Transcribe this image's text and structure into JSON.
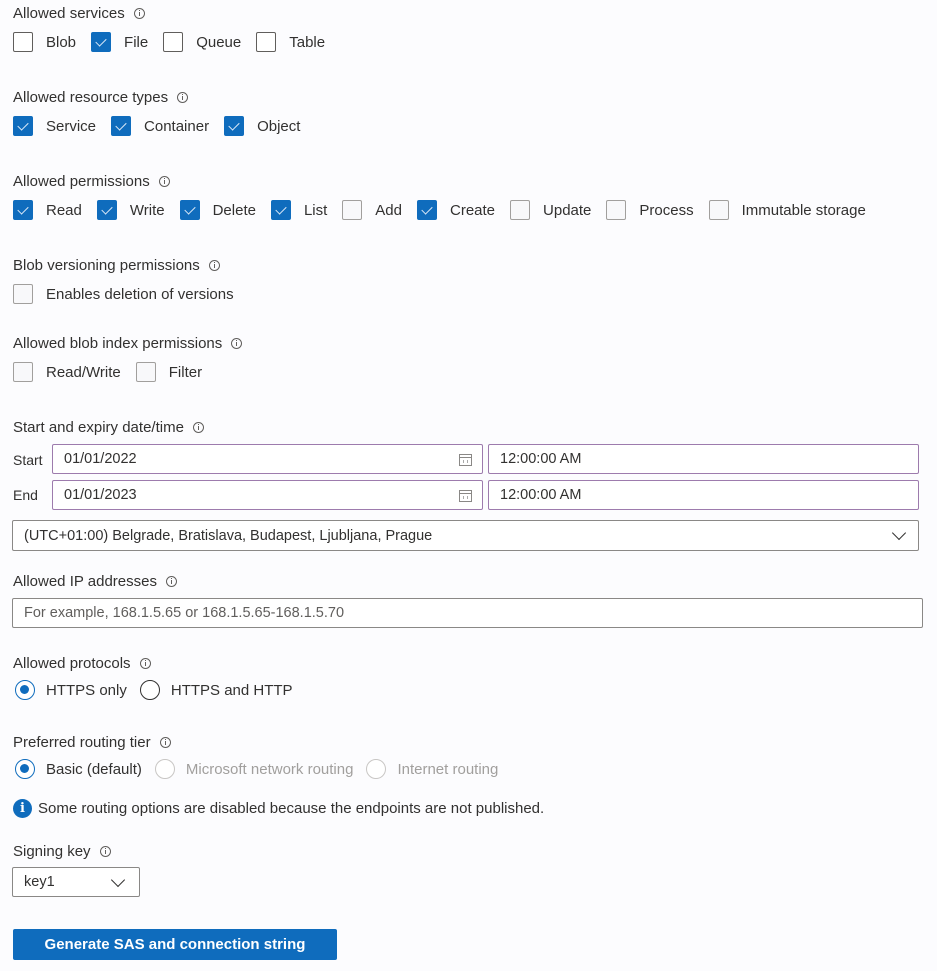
{
  "allowed_services": {
    "label": "Allowed services",
    "options": [
      {
        "label": "Blob",
        "checked": false
      },
      {
        "label": "File",
        "checked": true
      },
      {
        "label": "Queue",
        "checked": false
      },
      {
        "label": "Table",
        "checked": false
      }
    ]
  },
  "allowed_resource_types": {
    "label": "Allowed resource types",
    "options": [
      {
        "label": "Service",
        "checked": true
      },
      {
        "label": "Container",
        "checked": true
      },
      {
        "label": "Object",
        "checked": true
      }
    ]
  },
  "allowed_permissions": {
    "label": "Allowed permissions",
    "options": [
      {
        "label": "Read",
        "checked": true
      },
      {
        "label": "Write",
        "checked": true
      },
      {
        "label": "Delete",
        "checked": true
      },
      {
        "label": "List",
        "checked": true
      },
      {
        "label": "Add",
        "checked": false
      },
      {
        "label": "Create",
        "checked": true
      },
      {
        "label": "Update",
        "checked": false
      },
      {
        "label": "Process",
        "checked": false
      },
      {
        "label": "Immutable storage",
        "checked": false
      }
    ]
  },
  "blob_versioning": {
    "label": "Blob versioning permissions",
    "options": [
      {
        "label": "Enables deletion of versions",
        "checked": false
      }
    ]
  },
  "blob_index": {
    "label": "Allowed blob index permissions",
    "options": [
      {
        "label": "Read/Write",
        "checked": false
      },
      {
        "label": "Filter",
        "checked": false
      }
    ]
  },
  "dates": {
    "label": "Start and expiry date/time",
    "start_label": "Start",
    "end_label": "End",
    "start_date": "01/01/2022",
    "start_time": "12:00:00 AM",
    "end_date": "01/01/2023",
    "end_time": "12:00:00 AM",
    "timezone": "(UTC+01:00) Belgrade, Bratislava, Budapest, Ljubljana, Prague"
  },
  "ip": {
    "label": "Allowed IP addresses",
    "value": "",
    "placeholder": "For example, 168.1.5.65 or 168.1.5.65-168.1.5.70"
  },
  "protocols": {
    "label": "Allowed protocols",
    "options": [
      {
        "label": "HTTPS only",
        "selected": true
      },
      {
        "label": "HTTPS and HTTP",
        "selected": false
      }
    ]
  },
  "routing": {
    "label": "Preferred routing tier",
    "options": [
      {
        "label": "Basic (default)",
        "selected": true,
        "disabled": false
      },
      {
        "label": "Microsoft network routing",
        "selected": false,
        "disabled": true
      },
      {
        "label": "Internet routing",
        "selected": false,
        "disabled": true
      }
    ],
    "info_message": "Some routing options are disabled because the endpoints are not published."
  },
  "signing_key": {
    "label": "Signing key",
    "selected": "key1"
  },
  "generate_button": "Generate SAS and connection string",
  "colors": {
    "accent": "#0f6cbd",
    "focus_border": "#9d7bad"
  }
}
